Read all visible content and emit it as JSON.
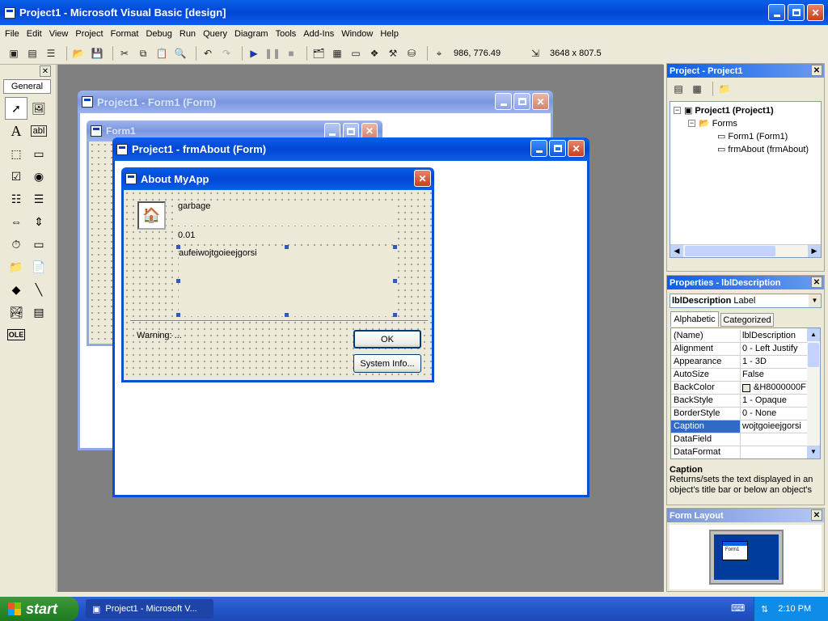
{
  "main_window": {
    "title": "Project1 - Microsoft Visual Basic [design]"
  },
  "menu": [
    "File",
    "Edit",
    "View",
    "Project",
    "Format",
    "Debug",
    "Run",
    "Query",
    "Diagram",
    "Tools",
    "Add-Ins",
    "Window",
    "Help"
  ],
  "toolbar": {
    "position": "986, 776.49",
    "size": "3648 x 807.5"
  },
  "toolbox": {
    "tab": "General"
  },
  "form1_window": {
    "title": "Project1 - Form1 (Form)",
    "inner_title": "Form1"
  },
  "frmabout_window": {
    "title": "Project1 - frmAbout (Form)"
  },
  "about_form": {
    "title": "About MyApp",
    "app_name": "garbage",
    "version": "0.01",
    "description": "aufeiwojtgoieejgorsi",
    "warning": "Warning: ...",
    "ok_button": "OK",
    "sysinfo_button": "System Info..."
  },
  "project_panel": {
    "title": "Project - Project1",
    "root": "Project1 (Project1)",
    "folder": "Forms",
    "items": [
      "Form1 (Form1)",
      "frmAbout (frmAbout)"
    ]
  },
  "properties_panel": {
    "title": "Properties - lblDescription",
    "object_name": "lblDescription",
    "object_type": "Label",
    "tabs": [
      "Alphabetic",
      "Categorized"
    ],
    "rows": [
      {
        "name": "(Name)",
        "value": "lblDescription"
      },
      {
        "name": "Alignment",
        "value": "0 - Left Justify"
      },
      {
        "name": "Appearance",
        "value": "1 - 3D"
      },
      {
        "name": "AutoSize",
        "value": "False"
      },
      {
        "name": "BackColor",
        "value": "&H8000000F"
      },
      {
        "name": "BackStyle",
        "value": "1 - Opaque"
      },
      {
        "name": "BorderStyle",
        "value": "0 - None"
      },
      {
        "name": "Caption",
        "value": "wojtgoieejgorsi"
      },
      {
        "name": "DataField",
        "value": ""
      },
      {
        "name": "DataFormat",
        "value": ""
      }
    ],
    "desc_title": "Caption",
    "desc_text": "Returns/sets the text displayed in an object's title bar or below an object's"
  },
  "form_layout": {
    "title": "Form Layout",
    "thumb_label": "Form1"
  },
  "taskbar": {
    "start": "start",
    "task": "Project1 - Microsoft V...",
    "clock": "2:10 PM"
  }
}
